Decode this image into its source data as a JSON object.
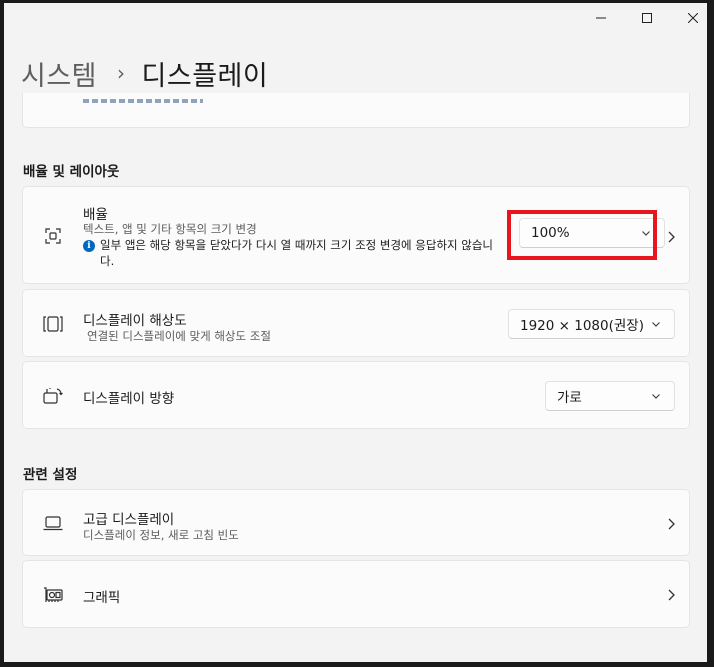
{
  "breadcrumb": {
    "parent": "시스템",
    "separator": "›",
    "current": "디스플레이"
  },
  "sections": {
    "scale_layout": "배율 및 레이아웃",
    "related": "관련 설정"
  },
  "scale": {
    "title": "배율",
    "subtitle": "텍스트, 앱 및 기타 항목의 크기 변경",
    "info": "일부 앱은 해당 항목을 닫았다가 다시 열 때까지 크기 조정 변경에 응답하지 않습니다.",
    "value": "100%"
  },
  "resolution": {
    "title": "디스플레이 해상도",
    "subtitle": "연결된 디스플레이에 맞게 해상도 조절",
    "value": "1920 × 1080(권장)"
  },
  "orientation": {
    "title": "디스플레이 방향",
    "value": "가로"
  },
  "advanced": {
    "title": "고급 디스플레이",
    "subtitle": "디스플레이 정보, 새로 고침 빈도"
  },
  "graphics": {
    "title": "그래픽"
  },
  "info_glyph": "i",
  "colors": {
    "accent": "#0067c0",
    "highlight": "#e8141e",
    "window_bg": "#f3f3f3",
    "card_bg": "#fbfbfb"
  }
}
